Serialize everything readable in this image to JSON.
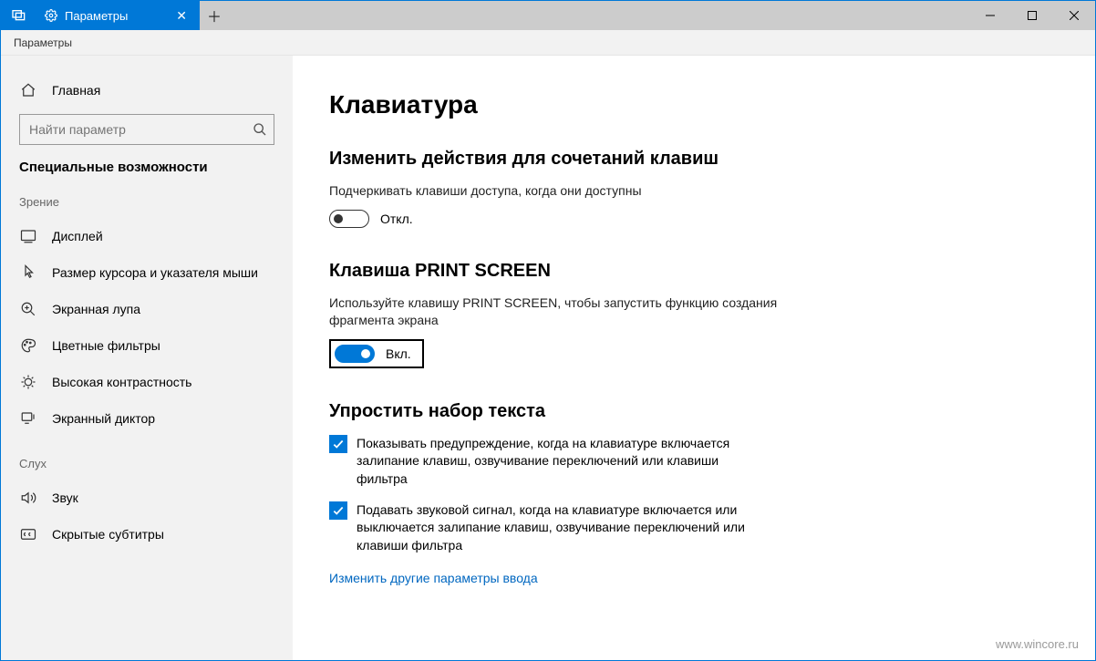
{
  "titlebar": {
    "tab_title": "Параметры",
    "close_glyph": "✕",
    "newtab_glyph": "＋"
  },
  "breadcrumb": "Параметры",
  "sidebar": {
    "home": "Главная",
    "search_placeholder": "Найти параметр",
    "category": "Специальные возможности",
    "groups": {
      "vision": "Зрение",
      "hearing": "Слух"
    },
    "items": {
      "display": "Дисплей",
      "cursor": "Размер курсора и указателя мыши",
      "magnifier": "Экранная лупа",
      "color_filters": "Цветные фильтры",
      "high_contrast": "Высокая контрастность",
      "narrator": "Экранный диктор",
      "audio": "Звук",
      "captions": "Скрытые субтитры"
    }
  },
  "content": {
    "title": "Клавиатура",
    "section1": {
      "heading": "Изменить действия для сочетаний клавиш",
      "desc": "Подчеркивать клавиши доступа, когда они доступны",
      "toggle_state": "Откл."
    },
    "section2": {
      "heading": "Клавиша PRINT SCREEN",
      "desc": "Используйте клавишу PRINT SCREEN, чтобы запустить функцию создания фрагмента экрана",
      "toggle_state": "Вкл."
    },
    "section3": {
      "heading": "Упростить набор текста",
      "check1": "Показывать предупреждение, когда на клавиатуре включается залипание клавиш, озвучивание переключений или клавиши фильтра",
      "check2": "Подавать звуковой сигнал, когда на клавиатуре включается или выключается залипание клавиш, озвучивание переключений или клавиши фильтра",
      "link": "Изменить другие параметры ввода"
    }
  },
  "watermark": "www.wincore.ru"
}
